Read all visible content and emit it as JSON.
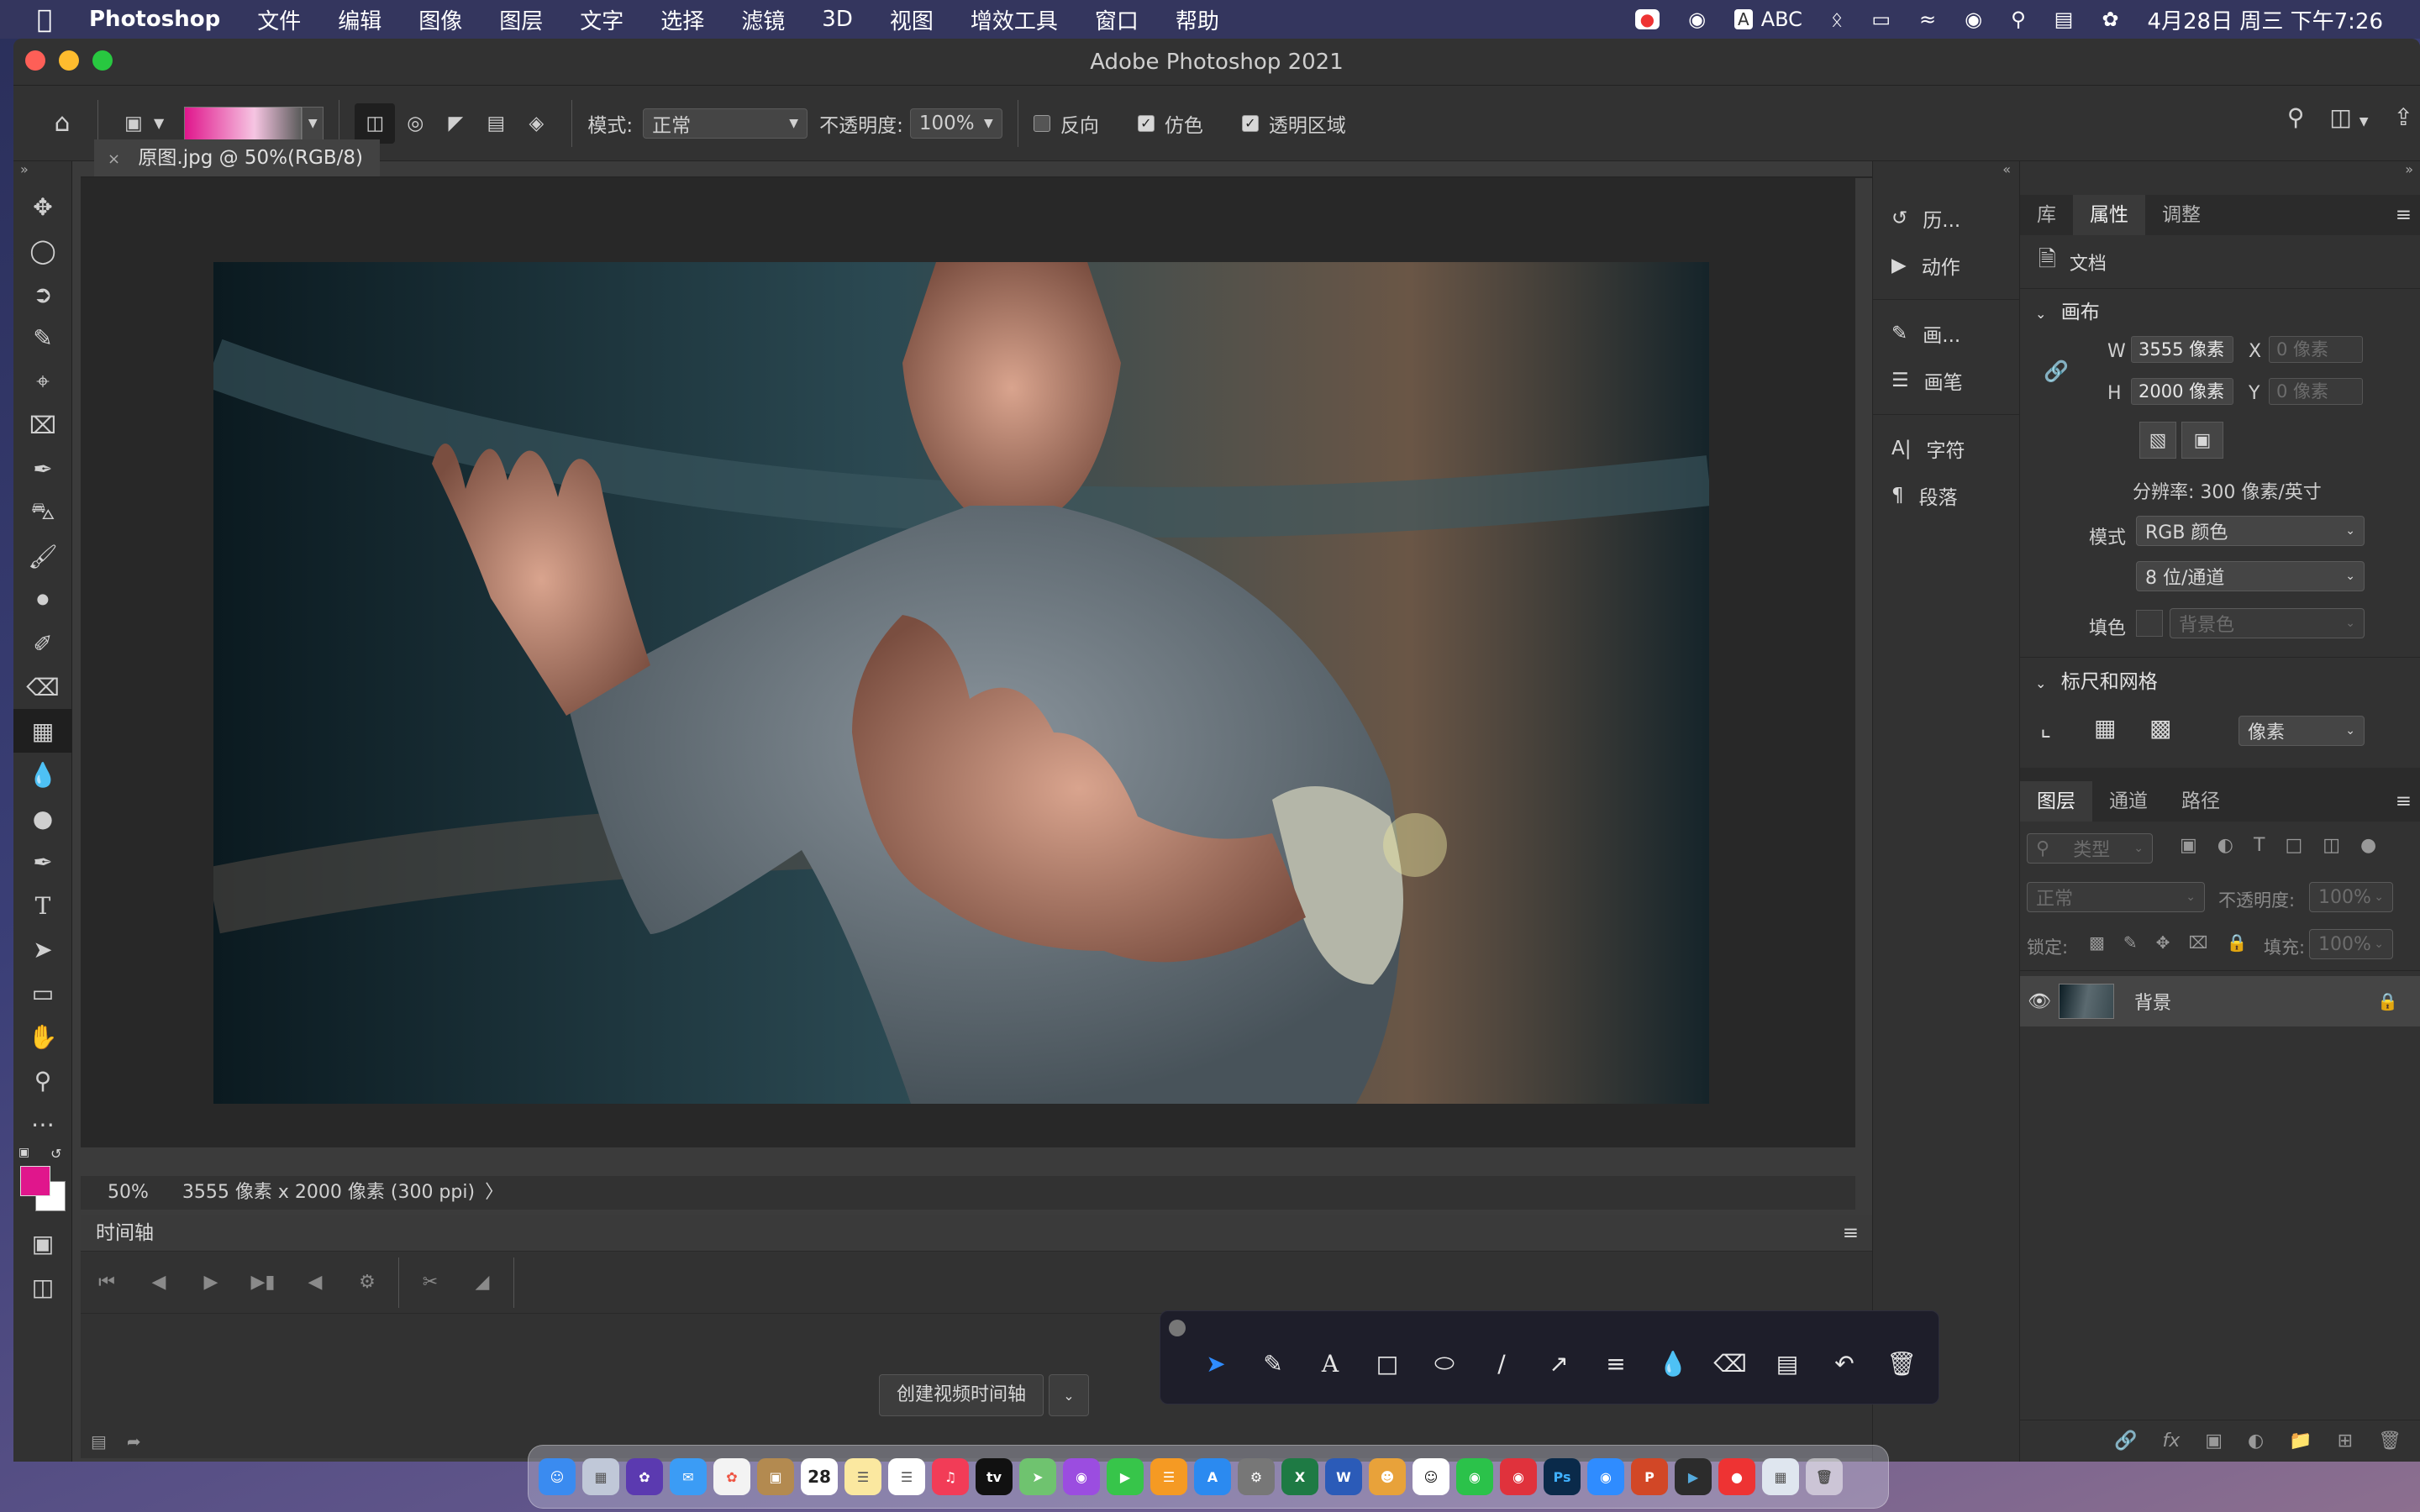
{
  "menubar": {
    "app_name": "Photoshop",
    "items": [
      "文件",
      "编辑",
      "图像",
      "图层",
      "文字",
      "选择",
      "滤镜",
      "3D",
      "视图",
      "增效工具",
      "窗口",
      "帮助"
    ],
    "input_method": "ABC",
    "datetime": "4月28日 周三 下午7:26"
  },
  "window": {
    "title": "Adobe Photoshop 2021"
  },
  "options": {
    "mode_label": "模式:",
    "mode_value": "正常",
    "opacity_label": "不透明度:",
    "opacity_value": "100%",
    "reverse_label": "反向",
    "reverse_checked": false,
    "dither_label": "仿色",
    "dither_checked": true,
    "transparency_label": "透明区域",
    "transparency_checked": true,
    "gradient_colors": [
      "#e0168c",
      "#f6c5e2"
    ]
  },
  "document": {
    "tab_title": "原图.jpg @ 50%(RGB/8)",
    "zoom": "50%",
    "info": "3555 像素 x 2000 像素 (300 ppi)"
  },
  "timeline": {
    "title": "时间轴",
    "create_button": "创建视频时间轴"
  },
  "midpanel": {
    "items": [
      "历...",
      "动作",
      "画...",
      "画笔",
      "字符",
      "段落"
    ]
  },
  "properties": {
    "tabs": [
      "库",
      "属性",
      "调整"
    ],
    "active_tab": "属性",
    "doc_label": "文档",
    "canvas_title": "画布",
    "w_label": "W",
    "w_value": "3555 像素",
    "h_label": "H",
    "h_value": "2000 像素",
    "x_label": "X",
    "x_placeholder": "0 像素",
    "y_label": "Y",
    "y_placeholder": "0 像素",
    "resolution": "分辨率: 300 像素/英寸",
    "mode_label": "模式",
    "mode_value": "RGB 颜色",
    "depth_value": "8 位/通道",
    "fill_label": "填色",
    "fill_value": "背景色",
    "rulers_title": "标尺和网格",
    "units_value": "像素"
  },
  "layers": {
    "tabs": [
      "图层",
      "通道",
      "路径"
    ],
    "active_tab": "图层",
    "filter_placeholder": "类型",
    "blend_value": "正常",
    "opacity_label": "不透明度:",
    "opacity_value": "100%",
    "lock_label": "锁定:",
    "fill_label": "填充:",
    "fill_value": "100%",
    "items": [
      {
        "name": "背景",
        "visible": true,
        "locked": true
      }
    ]
  },
  "colors": {
    "foreground": "#e0168c",
    "background": "#ffffff"
  },
  "dock": {
    "calendar_day": "28"
  }
}
